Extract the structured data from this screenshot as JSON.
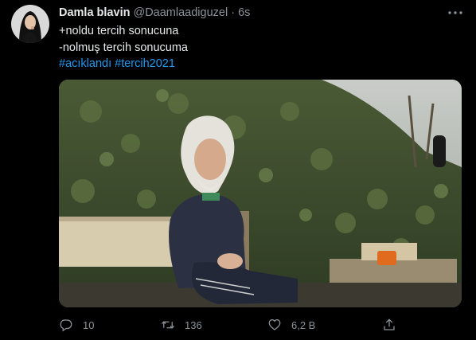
{
  "tweet": {
    "author_name": "Damla blavin",
    "author_handle": "@Daamlaadiguzel",
    "separator": "·",
    "time": "6s",
    "text_line1": "+noldu tercih sonucuna",
    "text_line2": "-nolmuş tercih sonucuma",
    "hashtag1": "#acıklandı",
    "hashtag2": "#tercih2021"
  },
  "actions": {
    "reply_count": "10",
    "retweet_count": "136",
    "like_count": "6,2 B"
  },
  "icons": {
    "reply": "reply-icon",
    "retweet": "retweet-icon",
    "like": "heart-icon",
    "share": "share-icon",
    "more": "more-icon"
  },
  "colors": {
    "background": "#000000",
    "text": "#e7e9ea",
    "muted": "#8b9298",
    "link": "#1d9bf0"
  }
}
